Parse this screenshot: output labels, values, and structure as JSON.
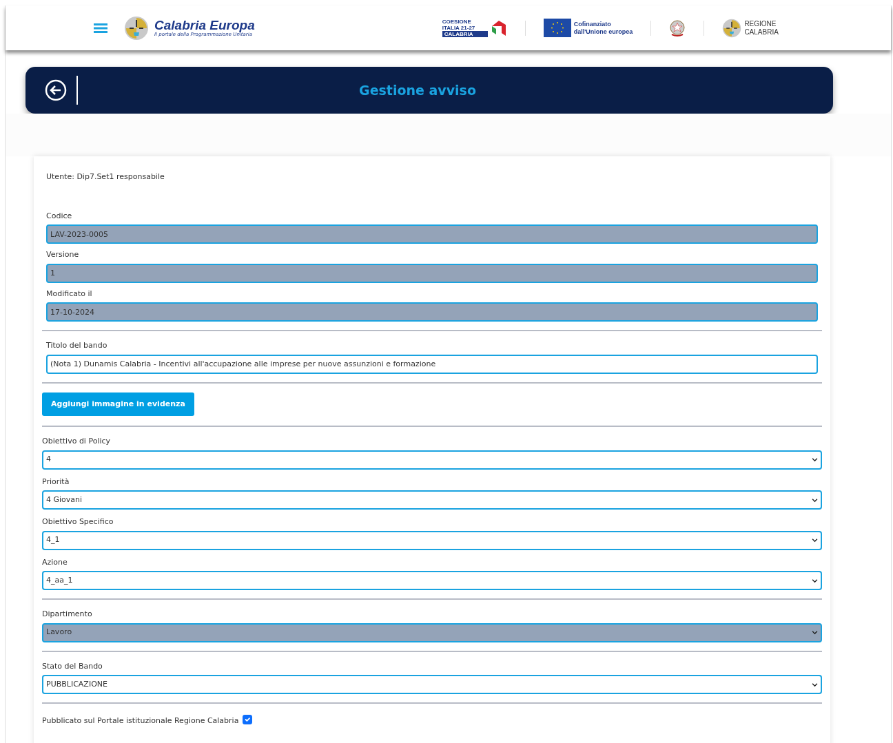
{
  "header": {
    "brand_title": "Calabria Europa",
    "brand_subtitle": "Il portale della Programmazione Unitaria",
    "coesione": {
      "line1": "COESIONE",
      "line2": "ITALIA",
      "years": "21-27",
      "region": "CALABRIA"
    },
    "eu": {
      "line1": "Cofinanziato",
      "line2": "dall'Unione europea"
    },
    "regione": {
      "line1": "REGIONE",
      "line2": "CALABRIA"
    }
  },
  "banner": {
    "title": "Gestione avviso"
  },
  "form": {
    "user": "Utente: Dip7.Set1 responsabile",
    "items": [
      {
        "kind": "input",
        "label": "Codice",
        "value": "LAV-2023-0005",
        "disabled": true
      },
      {
        "kind": "input",
        "label": "Versione",
        "value": "1",
        "disabled": true
      },
      {
        "kind": "input",
        "label": "Modificato il",
        "value": "17-10-2024",
        "disabled": true
      },
      {
        "kind": "divider"
      },
      {
        "kind": "input",
        "label": "Titolo del bando",
        "value": "(Nota 1) Dunamis Calabria - Incentivi all'accupazione alle imprese per nuove assunzioni e formazione",
        "disabled": false
      },
      {
        "kind": "divider"
      },
      {
        "kind": "button",
        "label": "Aggiungi immagine in evidenza"
      },
      {
        "kind": "divider"
      },
      {
        "kind": "select",
        "label": "Obiettivo di Policy",
        "value": "4",
        "disabled": false
      },
      {
        "kind": "select",
        "label": "Priorità",
        "value": "4 Giovani",
        "disabled": false
      },
      {
        "kind": "select",
        "label": "Obiettivo Specifico",
        "value": "4_1",
        "disabled": false
      },
      {
        "kind": "select",
        "label": "Azione",
        "value": "4_aa_1",
        "disabled": false
      },
      {
        "kind": "divider"
      },
      {
        "kind": "select",
        "label": "Dipartimento",
        "value": "Lavoro",
        "disabled": true
      },
      {
        "kind": "divider"
      },
      {
        "kind": "select",
        "label": "Stato del Bando",
        "value": "PUBBLICAZIONE",
        "disabled": false
      },
      {
        "kind": "divider"
      },
      {
        "kind": "checkbox",
        "label": "Pubblicato sul Portale istituzionale Regione Calabria",
        "checked": true
      }
    ]
  }
}
